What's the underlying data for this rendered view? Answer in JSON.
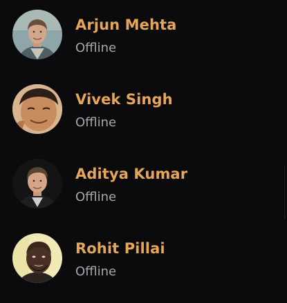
{
  "contacts": [
    {
      "name": "Arjun Mehta",
      "status": "Offline",
      "avatar": "avatar-arjun"
    },
    {
      "name": "Vivek Singh",
      "status": "Offline",
      "avatar": "avatar-vivek"
    },
    {
      "name": "Aditya Kumar",
      "status": "Offline",
      "avatar": "avatar-aditya"
    },
    {
      "name": "Rohit Pillai",
      "status": "Offline",
      "avatar": "avatar-rohit"
    }
  ],
  "colors": {
    "background": "#0b0b0d",
    "name": "#e5a65a",
    "status": "#a8a8ac"
  }
}
